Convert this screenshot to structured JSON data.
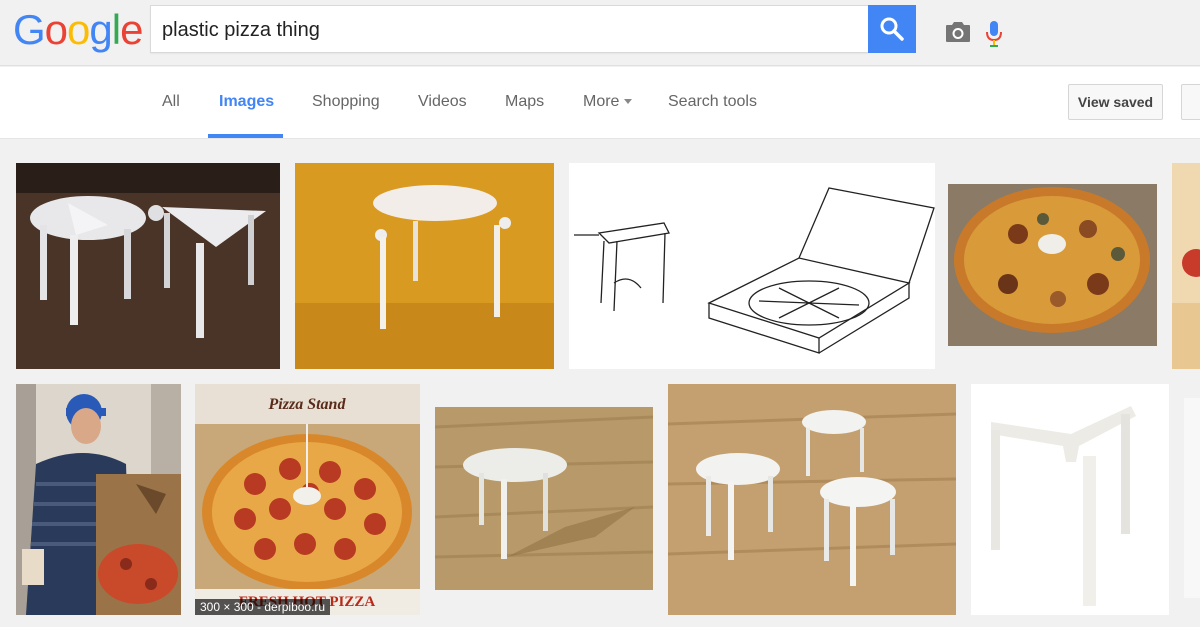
{
  "logo": {
    "text": [
      "G",
      "o",
      "o",
      "g",
      "l",
      "e"
    ],
    "colors": [
      "#4285f4",
      "#ea4335",
      "#fbbc05",
      "#4285f4",
      "#34a853",
      "#ea4335"
    ]
  },
  "search": {
    "query": "plastic pizza thing"
  },
  "tabs": [
    {
      "label": "All",
      "active": false
    },
    {
      "label": "Images",
      "active": true
    },
    {
      "label": "Shopping",
      "active": false
    },
    {
      "label": "Videos",
      "active": false
    },
    {
      "label": "Maps",
      "active": false
    },
    {
      "label": "More",
      "active": false
    },
    {
      "label": "Search tools",
      "active": false
    }
  ],
  "view_saved_label": "View saved",
  "accent": "#4285f4",
  "images": [
    {
      "subject": "two plastic pizza savers, round and triangular, on dark wood"
    },
    {
      "subject": "white three-legged pizza saver on yellow background"
    },
    {
      "subject": "patent line drawing of pizza saver and pizza box"
    },
    {
      "subject": "pizza with saver in delivery box"
    },
    {
      "subject": "partial image on right edge"
    },
    {
      "subject": "man in cap holding open pizza box"
    },
    {
      "subject": "pepperoni pizza with stand, box labeled",
      "box_title": "Pizza Stand",
      "box_text": "FRESH HOT PIZZA",
      "caption": "300 × 300 - derpiboo.ru"
    },
    {
      "subject": "single pizza saver on wooden table"
    },
    {
      "subject": "three pizza savers on wooden surface"
    },
    {
      "subject": "Y-shaped white pizza tripod"
    },
    {
      "subject": "partial image on right edge"
    }
  ]
}
